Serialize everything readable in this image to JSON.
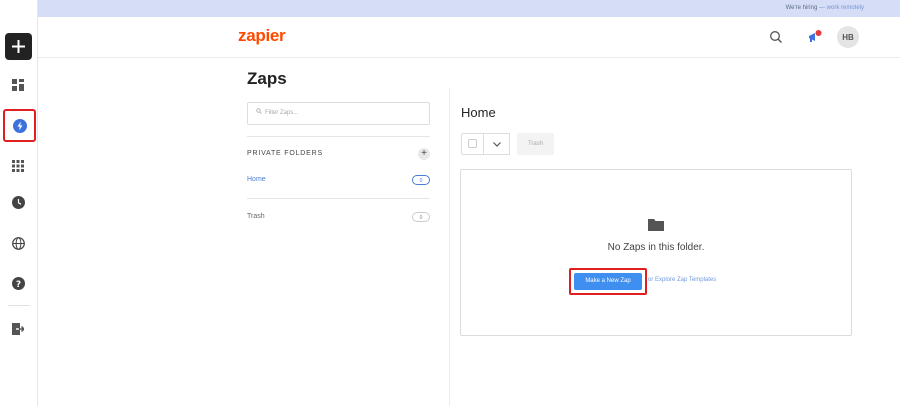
{
  "banner": {
    "text": "We're hiring",
    "link": "— work remotely"
  },
  "header": {
    "logo": "zapier",
    "avatar_initials": "HB"
  },
  "rail": {
    "items": [
      {
        "name": "plus-icon"
      },
      {
        "name": "dashboard-icon"
      },
      {
        "name": "zaps-icon"
      },
      {
        "name": "apps-grid-icon"
      },
      {
        "name": "history-icon"
      },
      {
        "name": "globe-icon"
      },
      {
        "name": "help-icon"
      },
      {
        "name": "logout-icon"
      }
    ]
  },
  "page": {
    "title": "Zaps"
  },
  "folders": {
    "filter_placeholder": "Filter Zaps...",
    "heading": "PRIVATE FOLDERS",
    "add_label": "+",
    "items": [
      {
        "label": "Home",
        "count": "0",
        "active": true
      },
      {
        "label": "Trash",
        "count": "0",
        "active": false
      }
    ]
  },
  "content": {
    "title": "Home",
    "trash_label": "Trash",
    "empty_message": "No Zaps in this folder.",
    "make_button": "Make a New Zap",
    "explore_text": "or Explore Zap Templates"
  },
  "colors": {
    "accent": "#ff4a00",
    "primary_button": "#3f8ff0",
    "link": "#4a7fd4",
    "highlight": "#e02020"
  }
}
